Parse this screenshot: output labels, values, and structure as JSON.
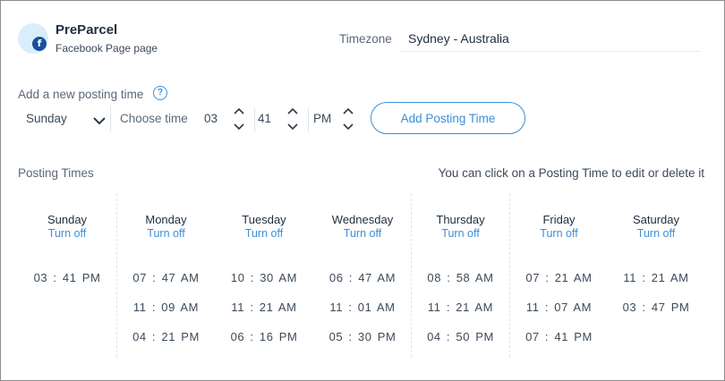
{
  "account": {
    "name": "PreParcel",
    "type": "Facebook Page page",
    "badge_icon": "facebook-icon",
    "badge_glyph": "f"
  },
  "timezone": {
    "label": "Timezone",
    "value": "Sydney - Australia"
  },
  "add_posting": {
    "label": "Add a new posting time",
    "help_glyph": "?",
    "day_value": "Sunday",
    "choose_time_label": "Choose time",
    "hour": "03",
    "minute": "41",
    "period": "PM",
    "button_label": "Add Posting Time"
  },
  "posting_times": {
    "label": "Posting Times",
    "hint": "You can click on a Posting Time to edit or delete it",
    "days": [
      {
        "name": "Sunday",
        "toggle": "Turn off",
        "times": [
          "03 : 41 PM"
        ]
      },
      {
        "name": "Monday",
        "toggle": "Turn off",
        "times": [
          "07 : 47 AM",
          "11 : 09 AM",
          "04 : 21 PM"
        ]
      },
      {
        "name": "Tuesday",
        "toggle": "Turn off",
        "times": [
          "10 : 30 AM",
          "11 : 21 AM",
          "06 : 16 PM"
        ]
      },
      {
        "name": "Wednesday",
        "toggle": "Turn off",
        "times": [
          "06 : 47 AM",
          "11 : 01 AM",
          "05 : 30 PM"
        ]
      },
      {
        "name": "Thursday",
        "toggle": "Turn off",
        "times": [
          "08 : 58 AM",
          "11 : 21 AM",
          "04 : 50 PM"
        ]
      },
      {
        "name": "Friday",
        "toggle": "Turn off",
        "times": [
          "07 : 21 AM",
          "11 : 07 AM",
          "07 : 41 PM"
        ]
      },
      {
        "name": "Saturday",
        "toggle": "Turn off",
        "times": [
          "11 : 21 AM",
          "03 : 47 PM"
        ]
      }
    ]
  },
  "colors": {
    "accent": "#3b8fd8",
    "facebook": "#1a4f9c",
    "text": "#3c4a5a"
  }
}
